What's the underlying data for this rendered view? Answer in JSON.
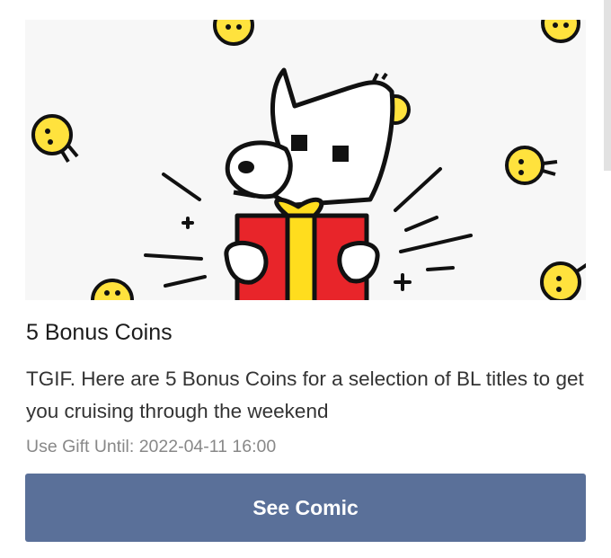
{
  "gift": {
    "title": "5 Bonus Coins",
    "description": "TGIF. Here are 5 Bonus Coins for a selection of BL titles to get you cruising through the weekend",
    "expiry": "Use Gift Until: 2022-04-11 16:00",
    "button_label": "See Comic"
  },
  "banner": {
    "background_color": "#f7f7f7",
    "coin_color": "#ffe23d",
    "gift_box_color": "#e8252a",
    "ribbon_color": "#ffdd1e",
    "character_color": "#ffffff",
    "outline_color": "#111111"
  },
  "colors": {
    "button": "#5a7099",
    "title_text": "#1c1c1c",
    "body_text": "#333333",
    "muted_text": "#888888"
  }
}
